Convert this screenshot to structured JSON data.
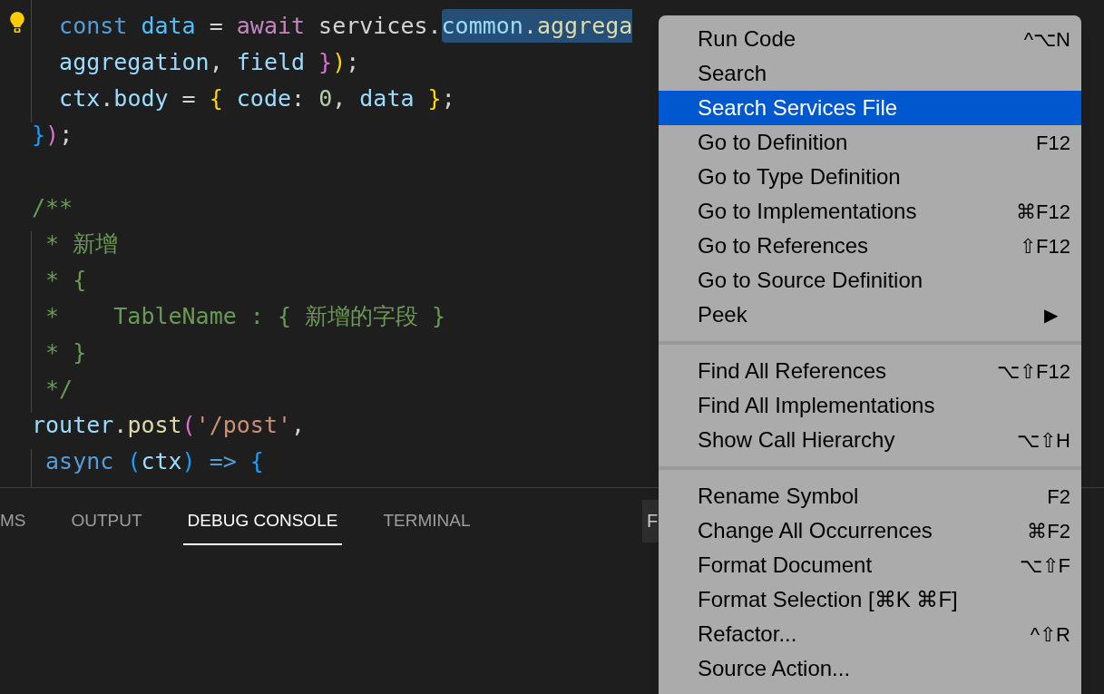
{
  "editor": {
    "lines": [
      {
        "kind": "code",
        "tokens": [
          {
            "text": "  const",
            "kind": "keyword"
          },
          {
            "text": " data",
            "kind": "constant"
          },
          {
            "text": " = ",
            "kind": "plain"
          },
          {
            "text": "await",
            "kind": "control"
          },
          {
            "text": " services.",
            "kind": "plain"
          }
        ],
        "selection": [
          {
            "text": "common",
            "kind": "variable"
          },
          {
            "text": ".",
            "kind": "plain"
          },
          {
            "text": "aggrega",
            "kind": "function"
          }
        ]
      },
      {
        "kind": "code",
        "tokens": [
          {
            "text": "  aggregation",
            "kind": "variable"
          },
          {
            "text": ", ",
            "kind": "plain"
          },
          {
            "text": "field",
            "kind": "variable"
          },
          {
            "text": " }",
            "kind": "bracket2"
          },
          {
            "text": ")",
            "kind": "bracket1"
          },
          {
            "text": ";",
            "kind": "plain"
          }
        ]
      },
      {
        "kind": "code",
        "tokens": [
          {
            "text": "  ctx",
            "kind": "variable"
          },
          {
            "text": ".",
            "kind": "plain"
          },
          {
            "text": "body",
            "kind": "variable"
          },
          {
            "text": " = ",
            "kind": "plain"
          },
          {
            "text": "{",
            "kind": "bracket1"
          },
          {
            "text": " code",
            "kind": "variable"
          },
          {
            "text": ": ",
            "kind": "plain"
          },
          {
            "text": "0",
            "kind": "number"
          },
          {
            "text": ", ",
            "kind": "plain"
          },
          {
            "text": "data",
            "kind": "variable"
          },
          {
            "text": " }",
            "kind": "bracket1"
          },
          {
            "text": ";",
            "kind": "plain"
          }
        ]
      },
      {
        "kind": "code",
        "tokens": [
          {
            "text": "}",
            "kind": "bracket3"
          },
          {
            "text": ")",
            "kind": "bracket2"
          },
          {
            "text": ";",
            "kind": "plain"
          }
        ]
      },
      {
        "kind": "blank"
      },
      {
        "kind": "code",
        "tokens": [
          {
            "text": "/**",
            "kind": "comment"
          }
        ]
      },
      {
        "kind": "code",
        "tokens": [
          {
            "text": " * 新增",
            "kind": "comment"
          }
        ]
      },
      {
        "kind": "code",
        "tokens": [
          {
            "text": " * {",
            "kind": "comment"
          }
        ]
      },
      {
        "kind": "code",
        "tokens": [
          {
            "text": " *    TableName : { 新增的字段 }",
            "kind": "comment"
          }
        ]
      },
      {
        "kind": "code",
        "tokens": [
          {
            "text": " * }",
            "kind": "comment"
          }
        ]
      },
      {
        "kind": "code",
        "tokens": [
          {
            "text": " */",
            "kind": "comment"
          }
        ]
      },
      {
        "kind": "code",
        "tokens": [
          {
            "text": "router",
            "kind": "variable"
          },
          {
            "text": ".",
            "kind": "plain"
          },
          {
            "text": "post",
            "kind": "function"
          },
          {
            "text": "(",
            "kind": "bracket2"
          },
          {
            "text": "'/post'",
            "kind": "string"
          },
          {
            "text": ",",
            "kind": "plain"
          }
        ]
      },
      {
        "kind": "code",
        "tokens": [
          {
            "text": " async",
            "kind": "keyword"
          },
          {
            "text": " (",
            "kind": "bracket3"
          },
          {
            "text": "ctx",
            "kind": "variable"
          },
          {
            "text": ")",
            "kind": "bracket3"
          },
          {
            "text": " =>",
            "kind": "keyword"
          },
          {
            "text": " {",
            "kind": "bracket3"
          }
        ]
      }
    ]
  },
  "panel": {
    "tabs": [
      {
        "label": "MS",
        "selected": false
      },
      {
        "label": "OUTPUT",
        "selected": false
      },
      {
        "label": "DEBUG CONSOLE",
        "selected": true
      },
      {
        "label": "TERMINAL",
        "selected": false
      }
    ],
    "field_text": "F"
  },
  "context_menu": {
    "items": [
      {
        "kind": "item",
        "label": "Run Code",
        "shortcut": "^⌥N",
        "selected": false
      },
      {
        "kind": "item",
        "label": "Search",
        "selected": false
      },
      {
        "kind": "item",
        "label": "Search Services File",
        "selected": true
      },
      {
        "kind": "item",
        "label": "Go to Definition",
        "shortcut": "F12",
        "selected": false
      },
      {
        "kind": "item",
        "label": "Go to Type Definition",
        "selected": false
      },
      {
        "kind": "item",
        "label": "Go to Implementations",
        "shortcut": "⌘F12",
        "selected": false
      },
      {
        "kind": "item",
        "label": "Go to References",
        "shortcut": "⇧F12",
        "selected": false
      },
      {
        "kind": "item",
        "label": "Go to Source Definition",
        "selected": false
      },
      {
        "kind": "item",
        "label": "Peek",
        "arrow": "▶",
        "selected": false
      },
      {
        "kind": "separator"
      },
      {
        "kind": "item",
        "label": "Find All References",
        "shortcut": "⌥⇧F12",
        "selected": false
      },
      {
        "kind": "item",
        "label": "Find All Implementations",
        "selected": false
      },
      {
        "kind": "item",
        "label": "Show Call Hierarchy",
        "shortcut": "⌥⇧H",
        "selected": false
      },
      {
        "kind": "separator"
      },
      {
        "kind": "item",
        "label": "Rename Symbol",
        "shortcut": "F2",
        "selected": false
      },
      {
        "kind": "item",
        "label": "Change All Occurrences",
        "shortcut": "⌘F2",
        "selected": false
      },
      {
        "kind": "item",
        "label": "Format Document",
        "shortcut": "⌥⇧F",
        "selected": false
      },
      {
        "kind": "item",
        "label": "Format Selection [⌘K ⌘F]",
        "selected": false
      },
      {
        "kind": "item",
        "label": "Refactor...",
        "shortcut": "^⇧R",
        "selected": false
      },
      {
        "kind": "item",
        "label": "Source Action...",
        "selected": false
      }
    ]
  }
}
